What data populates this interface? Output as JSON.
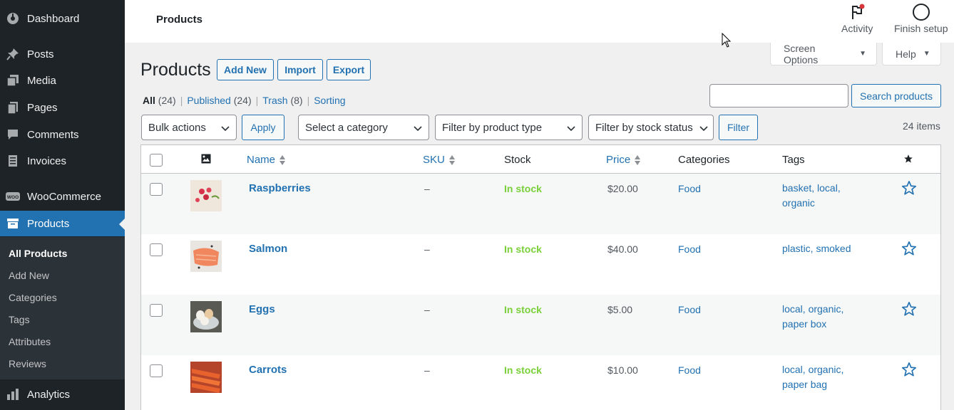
{
  "sidebar": {
    "items": [
      {
        "label": "Dashboard",
        "icon": "dashboard-icon"
      },
      {
        "label": "Posts",
        "icon": "pin-icon"
      },
      {
        "label": "Media",
        "icon": "media-icon"
      },
      {
        "label": "Pages",
        "icon": "pages-icon"
      },
      {
        "label": "Comments",
        "icon": "comment-icon"
      },
      {
        "label": "Invoices",
        "icon": "invoice-icon"
      },
      {
        "label": "WooCommerce",
        "icon": "woo-icon"
      },
      {
        "label": "Products",
        "icon": "archive-icon"
      },
      {
        "label": "Analytics",
        "icon": "bar-chart-icon"
      }
    ],
    "woo_badge": "WOO",
    "submenu": [
      "All Products",
      "Add New",
      "Categories",
      "Tags",
      "Attributes",
      "Reviews"
    ]
  },
  "topbar": {
    "title": "Products",
    "activity_label": "Activity",
    "finish_setup_label": "Finish setup"
  },
  "tabs": {
    "screen_options": "Screen Options",
    "help": "Help"
  },
  "heading": {
    "title": "Products",
    "add_new": "Add New",
    "import": "Import",
    "export": "Export"
  },
  "views": {
    "all": "All",
    "all_count": "(24)",
    "published": "Published",
    "published_count": "(24)",
    "trash": "Trash",
    "trash_count": "(8)",
    "sorting": "Sorting",
    "separator": "|"
  },
  "search": {
    "value": "",
    "button": "Search products"
  },
  "filters": {
    "bulk_actions": "Bulk actions",
    "apply": "Apply",
    "category": "Select a category",
    "product_type": "Filter by product type",
    "stock_status": "Filter by stock status",
    "filter": "Filter",
    "items_count": "24 items"
  },
  "table": {
    "columns": {
      "name": "Name",
      "sku": "SKU",
      "stock": "Stock",
      "price": "Price",
      "categories": "Categories",
      "tags": "Tags"
    },
    "rows": [
      {
        "name": "Raspberries",
        "sku": "–",
        "stock": "In stock",
        "price": "$20.00",
        "category": "Food",
        "tags_line1": "basket, local,",
        "tags_line2": "organic",
        "thumb": "raspberries"
      },
      {
        "name": "Salmon",
        "sku": "–",
        "stock": "In stock",
        "price": "$40.00",
        "category": "Food",
        "tags_line1": "plastic, smoked",
        "tags_line2": "",
        "thumb": "salmon"
      },
      {
        "name": "Eggs",
        "sku": "–",
        "stock": "In stock",
        "price": "$5.00",
        "category": "Food",
        "tags_line1": "local, organic,",
        "tags_line2": "paper box",
        "thumb": "eggs"
      },
      {
        "name": "Carrots",
        "sku": "–",
        "stock": "In stock",
        "price": "$10.00",
        "category": "Food",
        "tags_line1": "local, organic,",
        "tags_line2": "paper bag",
        "thumb": "carrots"
      }
    ]
  },
  "colors": {
    "accent": "#2271b1",
    "sidebar_bg": "#1d2327",
    "in_stock": "#7ad03a"
  }
}
